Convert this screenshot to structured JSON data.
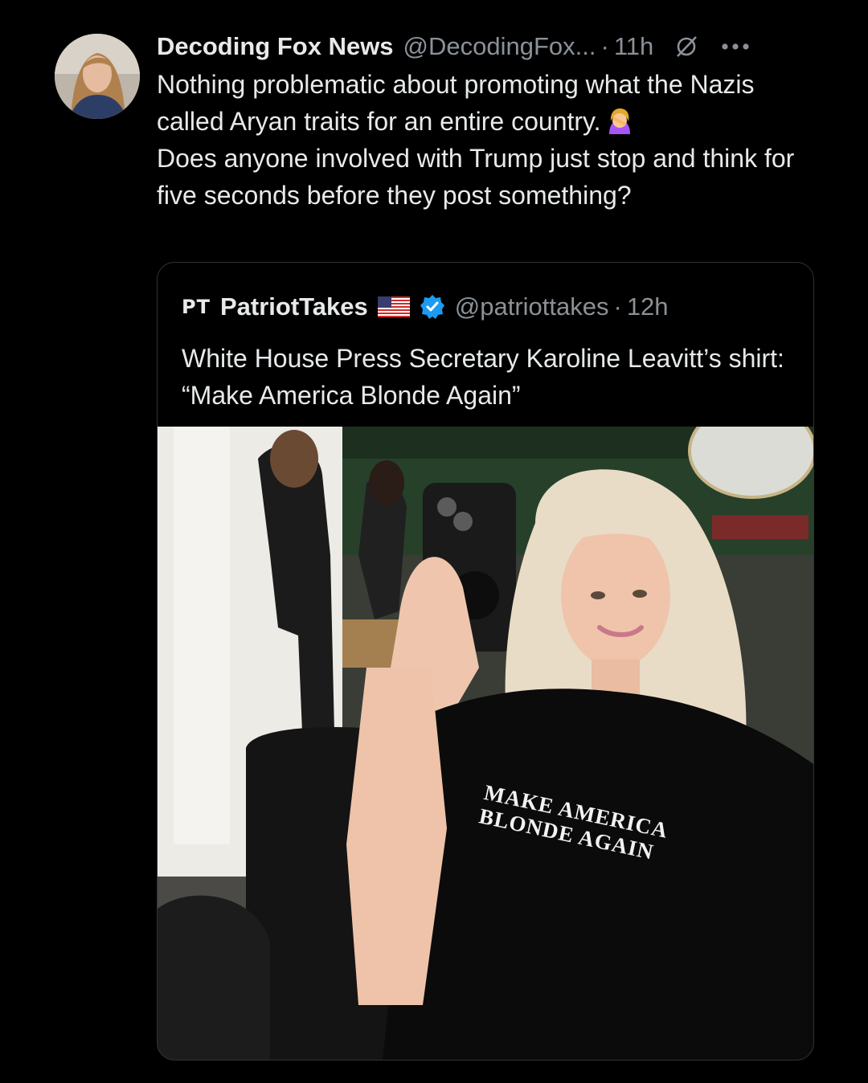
{
  "tweet": {
    "author_name": "Decoding Fox News",
    "handle": "@DecodingFox...",
    "separator": "·",
    "time": "11h",
    "text": "Nothing problematic about promoting what the Nazis called Aryan traits for an entire country.",
    "emoji": "woman-facepalming-icon",
    "text2": "Does anyone involved with Trump just stop and think for five seconds before they post something?"
  },
  "quote": {
    "logo": "PT",
    "name": "PatriotTakes",
    "flag_icon": "us-flag-icon",
    "verified_icon": "verified-badge-icon",
    "handle": "@patriottakes",
    "separator": "·",
    "time": "12h",
    "text": "White House Press Secretary Karoline Leavitt’s shirt: “Make America Blonde Again”",
    "image": {
      "shirt_line1": "MAKE AMERICA",
      "shirt_line2": "BLONDE AGAIN"
    }
  },
  "colors": {
    "background": "#000000",
    "text": "#e7e9ea",
    "secondary": "#8b9197",
    "border": "#2f3336",
    "verified": "#1d9bf0"
  }
}
